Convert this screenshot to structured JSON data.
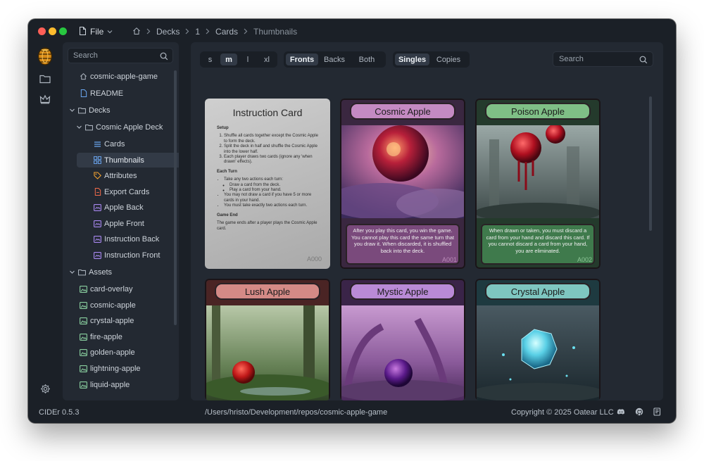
{
  "app": {
    "name": "CIDEr",
    "version": "CIDEr 0.5.3"
  },
  "titlebar": {
    "file_menu": "File",
    "breadcrumbs": [
      "Decks",
      "1",
      "Cards",
      "Thumbnails"
    ]
  },
  "sidebar": {
    "search_placeholder": "Search",
    "tree": [
      {
        "label": "cosmic-apple-game",
        "icon": "home-icon",
        "level": 1
      },
      {
        "label": "README",
        "icon": "document-icon",
        "level": 1
      },
      {
        "label": "Decks",
        "icon": "folder-icon",
        "level": 0,
        "expanded": true
      },
      {
        "label": "Cosmic Apple Deck",
        "icon": "folder-icon",
        "level": 1,
        "expanded": true
      },
      {
        "label": "Cards",
        "icon": "list-icon",
        "level": 2
      },
      {
        "label": "Thumbnails",
        "icon": "grid-icon",
        "level": 2,
        "selected": true
      },
      {
        "label": "Attributes",
        "icon": "tag-icon",
        "level": 2
      },
      {
        "label": "Export Cards",
        "icon": "pdf-icon",
        "level": 2
      },
      {
        "label": "Apple Back",
        "icon": "template-icon",
        "level": 2
      },
      {
        "label": "Apple Front",
        "icon": "template-icon",
        "level": 2
      },
      {
        "label": "Instruction Back",
        "icon": "template-icon",
        "level": 2
      },
      {
        "label": "Instruction Front",
        "icon": "template-icon",
        "level": 2
      },
      {
        "label": "Assets",
        "icon": "folder-icon",
        "level": 0,
        "expanded": true
      },
      {
        "label": "card-overlay",
        "icon": "image-icon",
        "level": 1
      },
      {
        "label": "cosmic-apple",
        "icon": "image-icon",
        "level": 1
      },
      {
        "label": "crystal-apple",
        "icon": "image-icon",
        "level": 1
      },
      {
        "label": "fire-apple",
        "icon": "image-icon",
        "level": 1
      },
      {
        "label": "golden-apple",
        "icon": "image-icon",
        "level": 1
      },
      {
        "label": "lightning-apple",
        "icon": "image-icon",
        "level": 1
      },
      {
        "label": "liquid-apple",
        "icon": "image-icon",
        "level": 1
      }
    ]
  },
  "toolbar": {
    "sizes": [
      "s",
      "m",
      "l",
      "xl"
    ],
    "size_selected": "m",
    "faces": [
      "Fronts",
      "Backs",
      "Both"
    ],
    "face_selected": "Fronts",
    "modes": [
      "Singles",
      "Copies"
    ],
    "mode_selected": "Singles",
    "search_placeholder": "Search"
  },
  "instruction_card": {
    "title": "Instruction Card",
    "setup_heading": "Setup",
    "setup_steps": [
      "Shuffle all cards together except the Cosmic Apple to form the deck.",
      "Split the deck in half and shuffle the Cosmic Apple into the lower half.",
      "Each player draws two cards (ignore any 'when drawn' effects)."
    ],
    "turn_heading": "Each Turn",
    "turn_steps": [
      "Take any two actions each turn:",
      "Draw a card from the deck.",
      "Play a card from your hand.",
      "You may not draw a card if you have 5 or more cards in your hand.",
      "You must take exactly two actions each turn."
    ],
    "end_heading": "Game End",
    "end_text": "The game ends after a player plays the Cosmic Apple card.",
    "code": "A000"
  },
  "cards": [
    {
      "name": "Cosmic Apple",
      "code": "A001",
      "text": "After you play this card, you win the game. You cannot play this card the same turn that you draw it. When discarded, it is shuffled back into the deck.",
      "theme": "purple"
    },
    {
      "name": "Poison Apple",
      "code": "A002",
      "text": "When drawn or taken, you must discard a card from your hand and discard this card. If you cannot discard a card from your hand, you are eliminated.",
      "theme": "green"
    },
    {
      "name": "Lush Apple",
      "code": "",
      "text": "",
      "theme": "red"
    },
    {
      "name": "Mystic Apple",
      "code": "",
      "text": "",
      "theme": "violet"
    },
    {
      "name": "Crystal Apple",
      "code": "",
      "text": "",
      "theme": "teal"
    }
  ],
  "statusbar": {
    "path": "/Users/hristo/Development/repos/cosmic-apple-game",
    "copyright": "Copyright © 2025 Oatear LLC"
  },
  "icons": {
    "discord": "discord-icon",
    "github": "github-icon",
    "docs": "book-icon"
  }
}
